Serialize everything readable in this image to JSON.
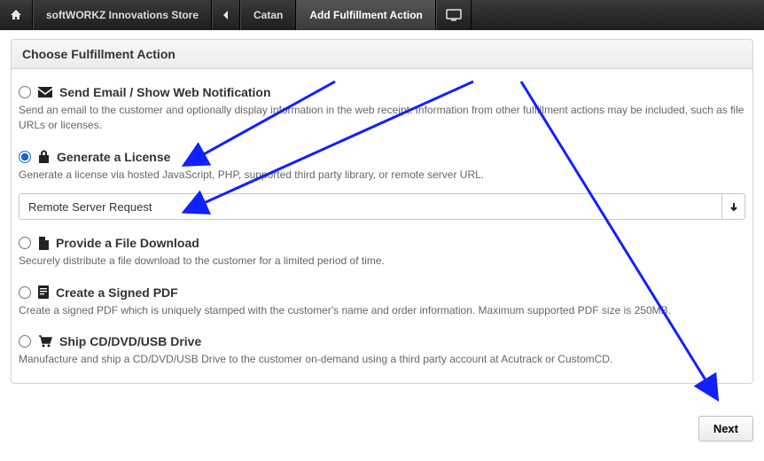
{
  "topbar": {
    "store_label": "softWORKZ Innovations Store",
    "crumb1": "Catan",
    "crumb2": "Add Fulfillment Action"
  },
  "panel": {
    "title": "Choose Fulfillment Action"
  },
  "options": [
    {
      "id": "email",
      "title": "Send Email / Show Web Notification",
      "desc": "Send an email to the customer and optionally display information in the web receipt. Information from other fulfillment actions may be included, such as file URLs or licenses.",
      "selected": false
    },
    {
      "id": "license",
      "title": "Generate a License",
      "desc": "Generate a license via hosted JavaScript, PHP, supported third party library, or remote server URL.",
      "selected": true,
      "dropdown": {
        "selected": "Remote Server Request"
      }
    },
    {
      "id": "file",
      "title": "Provide a File Download",
      "desc": "Securely distribute a file download to the customer for a limited period of time.",
      "selected": false
    },
    {
      "id": "pdf",
      "title": "Create a Signed PDF",
      "desc": "Create a signed PDF which is uniquely stamped with the customer's name and order information. Maximum supported PDF size is 250MB.",
      "selected": false
    },
    {
      "id": "ship",
      "title": "Ship CD/DVD/USB Drive",
      "desc": "Manufacture and ship a CD/DVD/USB Drive to the customer on-demand using a third party account at Acutrack or CustomCD.",
      "selected": false
    }
  ],
  "footer": {
    "next_label": "Next"
  }
}
